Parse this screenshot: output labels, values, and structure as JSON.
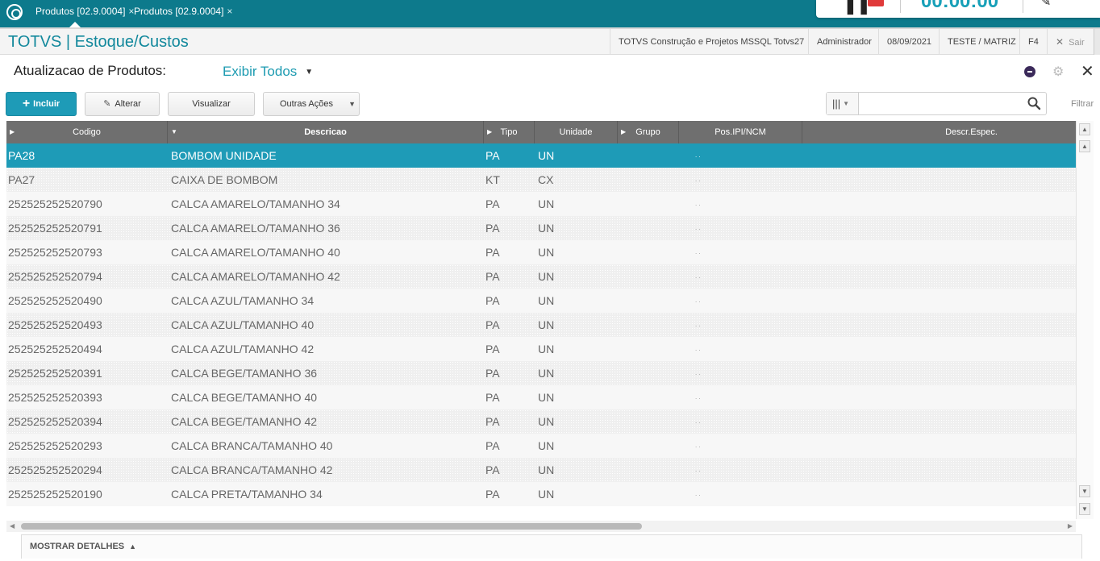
{
  "tabs": [
    {
      "label": "Produtos [02.9.0004]",
      "close": "×",
      "active": true
    },
    {
      "label": "Produtos [02.9.0004]",
      "close": "×",
      "active": false
    }
  ],
  "recorder": {
    "pause": "❚❚",
    "timer": "00:00:00",
    "edit": "✎"
  },
  "header": {
    "brand": "TOTVS | Estoque/Custos",
    "company": "TOTVS Construção e Projetos MSSQL Totvs27",
    "user": "Administrador",
    "date": "08/09/2021",
    "branch": "TESTE / MATRIZ",
    "shortcut": "F4",
    "exit_label": "Sair"
  },
  "page": {
    "title": "Atualizacao de Produtos:",
    "view": "Exibir Todos"
  },
  "toolbar": {
    "incluir": "Incluir",
    "alterar": "Alterar",
    "visualizar": "Visualizar",
    "outras": "Outras Ações",
    "filter_label": "Filtrar",
    "search_placeholder": ""
  },
  "grid": {
    "columns": [
      "Codigo",
      "Descricao",
      "Tipo",
      "Unidade",
      "Grupo",
      "Pos.IPI/NCM",
      "Descr.Espec."
    ],
    "rows": [
      {
        "code": "PA28",
        "desc": "BOMBOM UNIDADE",
        "tipo": "PA",
        "un": "UN",
        "ncm": ". .",
        "selected": true
      },
      {
        "code": "PA27",
        "desc": "CAIXA DE BOMBOM",
        "tipo": "KT",
        "un": "CX",
        "ncm": ". ."
      },
      {
        "code": "252525252520790",
        "desc": "CALCA AMARELO/TAMANHO 34",
        "tipo": "PA",
        "un": "UN",
        "ncm": ". ."
      },
      {
        "code": "252525252520791",
        "desc": "CALCA AMARELO/TAMANHO 36",
        "tipo": "PA",
        "un": "UN",
        "ncm": ". ."
      },
      {
        "code": "252525252520793",
        "desc": "CALCA AMARELO/TAMANHO 40",
        "tipo": "PA",
        "un": "UN",
        "ncm": ". ."
      },
      {
        "code": "252525252520794",
        "desc": "CALCA AMARELO/TAMANHO 42",
        "tipo": "PA",
        "un": "UN",
        "ncm": ". ."
      },
      {
        "code": "252525252520490",
        "desc": "CALCA AZUL/TAMANHO 34",
        "tipo": "PA",
        "un": "UN",
        "ncm": ". ."
      },
      {
        "code": "252525252520493",
        "desc": "CALCA AZUL/TAMANHO 40",
        "tipo": "PA",
        "un": "UN",
        "ncm": ". ."
      },
      {
        "code": "252525252520494",
        "desc": "CALCA AZUL/TAMANHO 42",
        "tipo": "PA",
        "un": "UN",
        "ncm": ". ."
      },
      {
        "code": "252525252520391",
        "desc": "CALCA BEGE/TAMANHO 36",
        "tipo": "PA",
        "un": "UN",
        "ncm": ". ."
      },
      {
        "code": "252525252520393",
        "desc": "CALCA BEGE/TAMANHO 40",
        "tipo": "PA",
        "un": "UN",
        "ncm": ". ."
      },
      {
        "code": "252525252520394",
        "desc": "CALCA BEGE/TAMANHO 42",
        "tipo": "PA",
        "un": "UN",
        "ncm": ". ."
      },
      {
        "code": "252525252520293",
        "desc": "CALCA BRANCA/TAMANHO 40",
        "tipo": "PA",
        "un": "UN",
        "ncm": ". ."
      },
      {
        "code": "252525252520294",
        "desc": "CALCA BRANCA/TAMANHO 42",
        "tipo": "PA",
        "un": "UN",
        "ncm": ". ."
      },
      {
        "code": "252525252520190",
        "desc": "CALCA PRETA/TAMANHO 34",
        "tipo": "PA",
        "un": "UN",
        "ncm": ". ."
      }
    ]
  },
  "footer": {
    "details": "MOSTRAR DETALHES"
  },
  "colors": {
    "brand": "#12889c",
    "tabstrip": "#0d7a8c",
    "accent": "#1e9bb7",
    "header_grid": "#6f6f6f",
    "recording": "#e03a3a"
  },
  "icons": [
    "app-logo-icon",
    "pause-icon",
    "stop-icon",
    "pencil-icon",
    "close-icon",
    "help-icon",
    "gear-icon",
    "plus-icon",
    "columns-icon",
    "search-icon",
    "chevron-up-icon"
  ]
}
